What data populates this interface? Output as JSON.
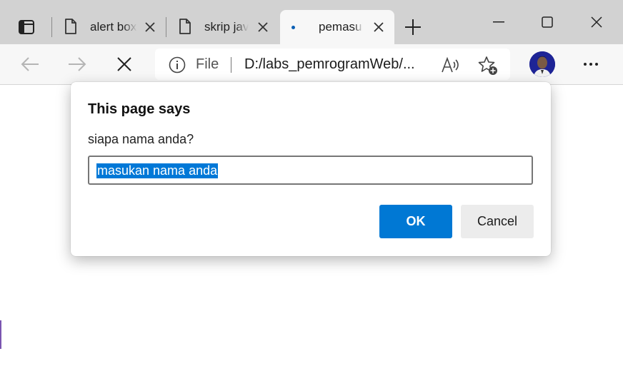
{
  "browser": {
    "tabs": [
      {
        "title": "alert box",
        "active": false
      },
      {
        "title": "skrip javascript",
        "active": false
      },
      {
        "title": "pemasukan",
        "active": true
      }
    ],
    "address": {
      "scheme_label": "File",
      "url": "D:/labs_pemrogramWeb/..."
    },
    "colors": {
      "tabstrip": "#d2d2d2",
      "toolbar": "#f7f7f7",
      "accent": "#0078d4"
    }
  },
  "dialog": {
    "title": "This page says",
    "message": "siapa nama anda?",
    "input_value": "masukan nama anda",
    "ok_label": "OK",
    "cancel_label": "Cancel"
  }
}
